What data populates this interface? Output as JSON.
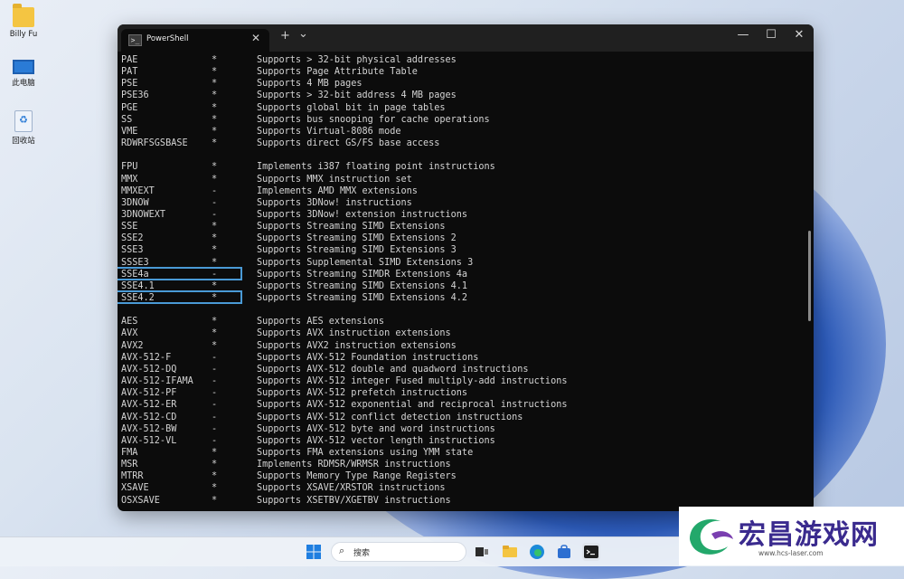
{
  "desktop": {
    "icons": [
      {
        "label": "Billy Fu",
        "icon": "folder-icon"
      },
      {
        "label": "此电脑",
        "icon": "computer-icon"
      },
      {
        "label": "回收站",
        "icon": "recycle-bin-icon"
      }
    ]
  },
  "window": {
    "tab_title": "PowerShell",
    "tab_close": "✕",
    "new_tab": "+",
    "dropdown": "⌄",
    "minimize": "—",
    "maximize": "☐",
    "close": "✕"
  },
  "terminal": {
    "lines": [
      {
        "name": "PAE",
        "flag": "*",
        "desc": "Supports > 32-bit physical addresses"
      },
      {
        "name": "PAT",
        "flag": "*",
        "desc": "Supports Page Attribute Table"
      },
      {
        "name": "PSE",
        "flag": "*",
        "desc": "Supports 4 MB pages"
      },
      {
        "name": "PSE36",
        "flag": "*",
        "desc": "Supports > 32-bit address 4 MB pages"
      },
      {
        "name": "PGE",
        "flag": "*",
        "desc": "Supports global bit in page tables"
      },
      {
        "name": "SS",
        "flag": "*",
        "desc": "Supports bus snooping for cache operations"
      },
      {
        "name": "VME",
        "flag": "*",
        "desc": "Supports Virtual-8086 mode"
      },
      {
        "name": "RDWRFSGSBASE",
        "flag": "*",
        "desc": "Supports direct GS/FS base access"
      },
      {
        "name": "",
        "flag": "",
        "desc": ""
      },
      {
        "name": "FPU",
        "flag": "*",
        "desc": "Implements i387 floating point instructions"
      },
      {
        "name": "MMX",
        "flag": "*",
        "desc": "Supports MMX instruction set"
      },
      {
        "name": "MMXEXT",
        "flag": "-",
        "desc": "Implements AMD MMX extensions"
      },
      {
        "name": "3DNOW",
        "flag": "-",
        "desc": "Supports 3DNow! instructions"
      },
      {
        "name": "3DNOWEXT",
        "flag": "-",
        "desc": "Supports 3DNow! extension instructions"
      },
      {
        "name": "SSE",
        "flag": "*",
        "desc": "Supports Streaming SIMD Extensions"
      },
      {
        "name": "SSE2",
        "flag": "*",
        "desc": "Supports Streaming SIMD Extensions 2"
      },
      {
        "name": "SSE3",
        "flag": "*",
        "desc": "Supports Streaming SIMD Extensions 3"
      },
      {
        "name": "SSSE3",
        "flag": "*",
        "desc": "Supports Supplemental SIMD Extensions 3"
      },
      {
        "name": "SSE4a",
        "flag": "-",
        "desc": "Supports Streaming SIMDR Extensions 4a",
        "highlight": true
      },
      {
        "name": "SSE4.1",
        "flag": "*",
        "desc": "Supports Streaming SIMD Extensions 4.1"
      },
      {
        "name": "SSE4.2",
        "flag": "*",
        "desc": "Supports Streaming SIMD Extensions 4.2",
        "highlight": true
      },
      {
        "name": "",
        "flag": "",
        "desc": ""
      },
      {
        "name": "AES",
        "flag": "*",
        "desc": "Supports AES extensions"
      },
      {
        "name": "AVX",
        "flag": "*",
        "desc": "Supports AVX instruction extensions"
      },
      {
        "name": "AVX2",
        "flag": "*",
        "desc": "Supports AVX2 instruction extensions"
      },
      {
        "name": "AVX-512-F",
        "flag": "-",
        "desc": "Supports AVX-512 Foundation instructions"
      },
      {
        "name": "AVX-512-DQ",
        "flag": "-",
        "desc": "Supports AVX-512 double and quadword instructions"
      },
      {
        "name": "AVX-512-IFAMA",
        "flag": "-",
        "desc": "Supports AVX-512 integer Fused multiply-add instructions"
      },
      {
        "name": "AVX-512-PF",
        "flag": "-",
        "desc": "Supports AVX-512 prefetch instructions"
      },
      {
        "name": "AVX-512-ER",
        "flag": "-",
        "desc": "Supports AVX-512 exponential and reciprocal instructions"
      },
      {
        "name": "AVX-512-CD",
        "flag": "-",
        "desc": "Supports AVX-512 conflict detection instructions"
      },
      {
        "name": "AVX-512-BW",
        "flag": "-",
        "desc": "Supports AVX-512 byte and word instructions"
      },
      {
        "name": "AVX-512-VL",
        "flag": "-",
        "desc": "Supports AVX-512 vector length instructions"
      },
      {
        "name": "FMA",
        "flag": "*",
        "desc": "Supports FMA extensions using YMM state"
      },
      {
        "name": "MSR",
        "flag": "*",
        "desc": "Implements RDMSR/WRMSR instructions"
      },
      {
        "name": "MTRR",
        "flag": "*",
        "desc": "Supports Memory Type Range Registers"
      },
      {
        "name": "XSAVE",
        "flag": "*",
        "desc": "Supports XSAVE/XRSTOR instructions"
      },
      {
        "name": "OSXSAVE",
        "flag": "*",
        "desc": "Supports XSETBV/XGETBV instructions"
      }
    ]
  },
  "taskbar": {
    "search_label": "搜索"
  },
  "watermark": {
    "title": "宏昌游戏网",
    "url": "www.hcs-laser.com"
  }
}
